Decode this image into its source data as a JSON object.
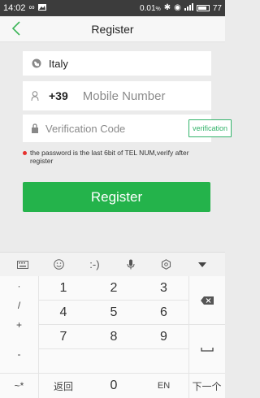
{
  "status_bar": {
    "time": "14:02",
    "left_icons": [
      "infinity-icon",
      "image-icon"
    ],
    "speed": "0.01",
    "battery": "77"
  },
  "nav": {
    "title": "Register",
    "back_icon": "chevron-left-icon"
  },
  "form": {
    "country": "Italy",
    "phone_prefix": "+39",
    "mobile_placeholder": "Mobile Number",
    "verification_placeholder": "Verification Code",
    "verification_button": "verification",
    "hint": "the password is the last 6bit of TEL NUM,verify after register",
    "register_button": "Register"
  },
  "keyboard": {
    "toolbar": [
      "keyboard-icon",
      "emoji-icon",
      ":-)",
      "mic-icon",
      "settings-icon",
      "collapse-icon"
    ],
    "toolbar_emoticon": ":-)",
    "left_column": [
      "·",
      "/",
      "+",
      "-",
      "~*"
    ],
    "digits": [
      "1",
      "2",
      "3",
      "4",
      "5",
      "6",
      "7",
      "8",
      "9",
      "0"
    ],
    "back_label": "返回",
    "en_label": "EN",
    "next_label": "下一个",
    "backspace_icon": "backspace-icon",
    "space_icon": "space-icon"
  },
  "colors": {
    "accent": "#24b34b",
    "hint_dot": "#e6312e"
  }
}
